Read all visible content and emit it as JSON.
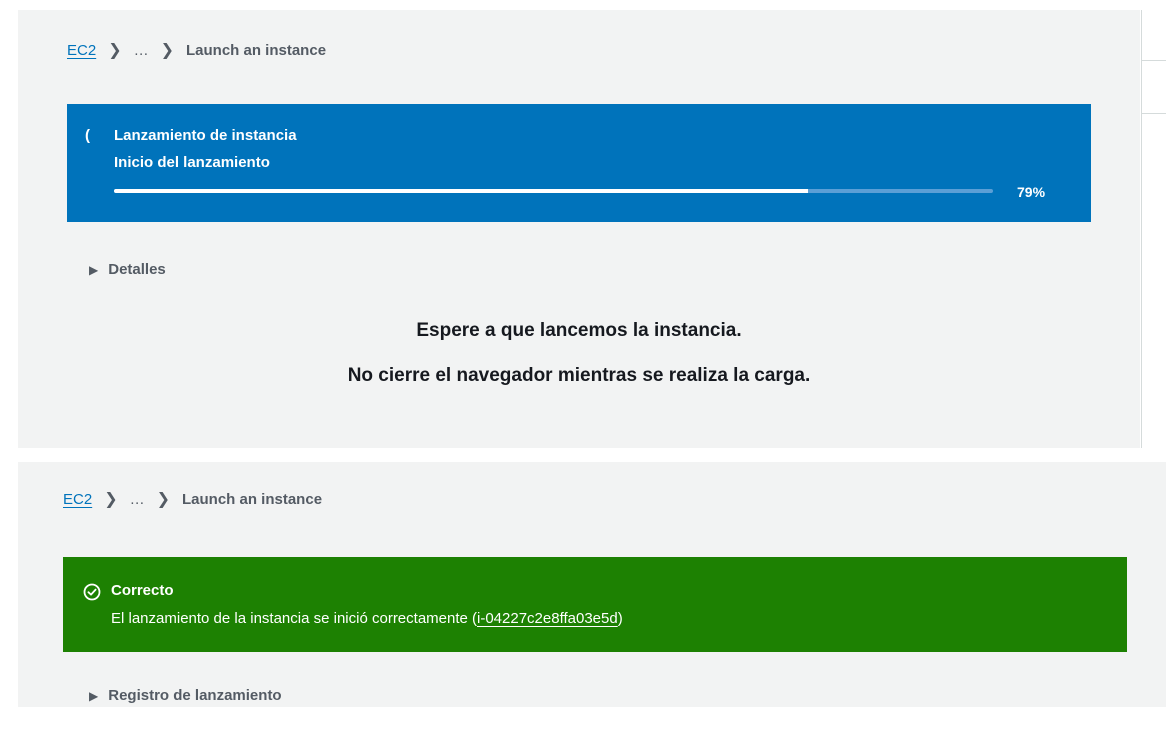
{
  "top_view": {
    "breadcrumb": {
      "root": "EC2",
      "ellipsis": "…",
      "current": "Launch an instance"
    },
    "progress_flash": {
      "spinner_glyph": "(",
      "title": "Lanzamiento de instancia",
      "subtitle": "Inicio del lanzamiento",
      "progress_value": 0.79,
      "progress_text": "79%",
      "background": "#0073bb"
    },
    "details_label": "Detalles",
    "waiting_line1": "Espere a que lancemos la instancia.",
    "waiting_line2": "No cierre el navegador mientras se realiza la carga."
  },
  "bottom_view": {
    "breadcrumb": {
      "root": "EC2",
      "ellipsis": "…",
      "current": "Launch an instance"
    },
    "success_flash": {
      "icon": "check-circle-icon",
      "title": "Correcto",
      "message_prefix": "El lanzamiento de la instancia se inició correctamente (",
      "instance_id": "i-04227c2e8ffa03e5d",
      "message_suffix": ")",
      "background": "#1d8102"
    },
    "launch_log_label": "Registro de lanzamiento"
  }
}
